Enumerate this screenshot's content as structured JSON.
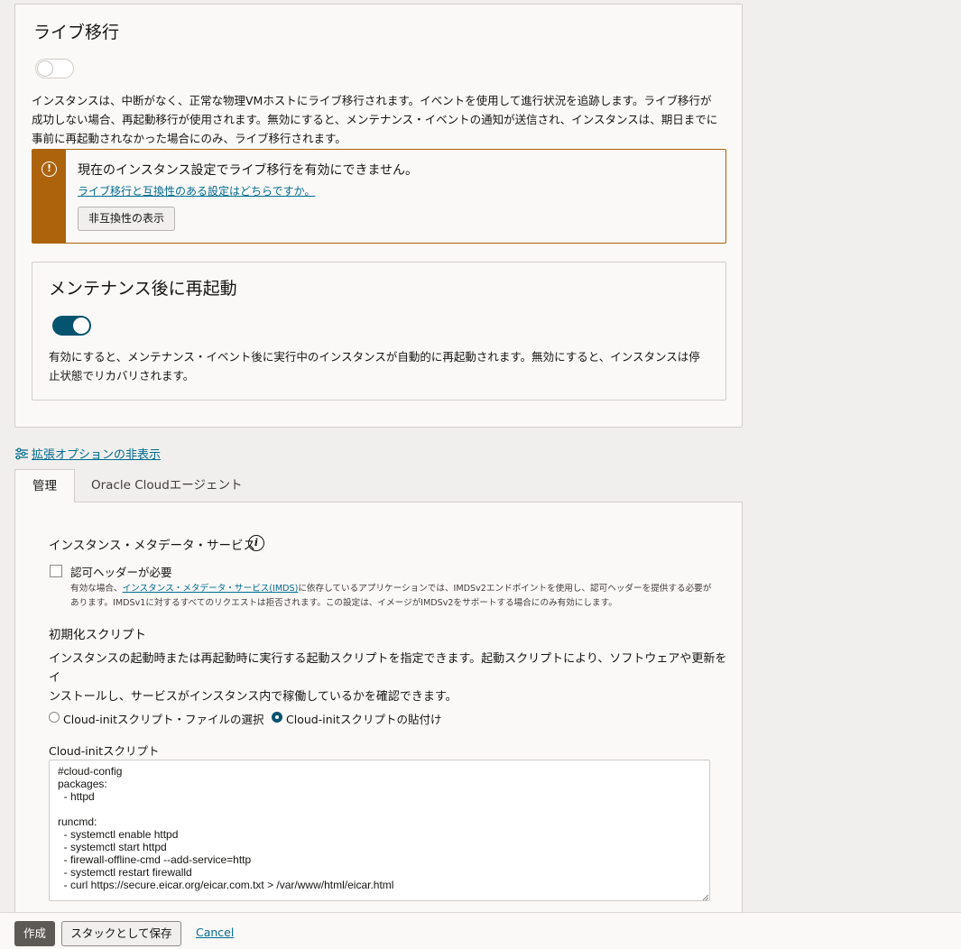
{
  "live_migration": {
    "title": "ライブ移行",
    "toggle_state": "off",
    "description_line1": "インスタンスは、中断がなく、正常な物理VMホストにライブ移行されます。イベントを使用して進行状況を追跡します。ライブ移行が",
    "description_line2": "成功しない場合、再起動移行が使用されます。無効にすると、メンテナンス・イベントの通知が送信され、インスタンスは、期日までに",
    "description_line3": "事前に再起動されなかった場合にのみ、ライブ移行されます。"
  },
  "warning": {
    "icon": "alert-icon",
    "message": "現在のインスタンス設定でライブ移行を有効にできません。",
    "link": "ライブ移行と互換性のある設定はどちらですか。",
    "button": "非互換性の表示",
    "color": "#ac630c"
  },
  "restart_after_maintenance": {
    "title": "メンテナンス後に再起動",
    "toggle_state": "on",
    "description_line1": "有効にすると、メンテナンス・イベント後に実行中のインスタンスが自動的に再起動されます。無効にすると、インスタンスは停",
    "description_line2": "止状態でリカバリされます。"
  },
  "advanced_options_link": "拡張オプションの非表示",
  "tabs": [
    {
      "label": "管理",
      "active": true
    },
    {
      "label": "Oracle Cloudエージェント",
      "active": false
    }
  ],
  "imds": {
    "title": "インスタンス・メタデータ・サービス",
    "checkbox_label": "認可ヘッダーが必要",
    "checked": false,
    "help_prefix": "有効な場合、",
    "help_link": "インスタンス・メタデータ・サービス(IMDS)",
    "help_suffix1": "に依存しているアプリケーションでは、IMDSv2エンドポイントを使用し、認可ヘッダーを提供する必要が",
    "help_line2": "あります。IMDSv1に対するすべてのリクエストは拒否されます。この設定は、イメージがIMDSv2をサポートする場合にのみ有効にします。"
  },
  "init_script": {
    "title": "初期化スクリプト",
    "description_line1": "インスタンスの起動時または再起動時に実行する起動スクリプトを指定できます。起動スクリプトにより、ソフトウェアや更新をイ",
    "description_line2": "ンストールし、サービスがインスタンス内で稼働しているかを確認できます。",
    "radio_file": "Cloud-initスクリプト・ファイルの選択",
    "radio_paste": "Cloud-initスクリプトの貼付け",
    "selected": "paste",
    "script_label": "Cloud-initスクリプト",
    "script_value": "#cloud-config\npackages:\n  - httpd\n\nruncmd:\n  - systemctl enable httpd\n  - systemctl start httpd\n  - firewall-offline-cmd --add-service=http\n  - systemctl restart firewalld\n  - curl https://secure.eicar.org/eicar.com.txt > /var/www/html/eicar.html"
  },
  "footer": {
    "create": "作成",
    "save_stack": "スタックとして保存",
    "cancel": "Cancel"
  }
}
